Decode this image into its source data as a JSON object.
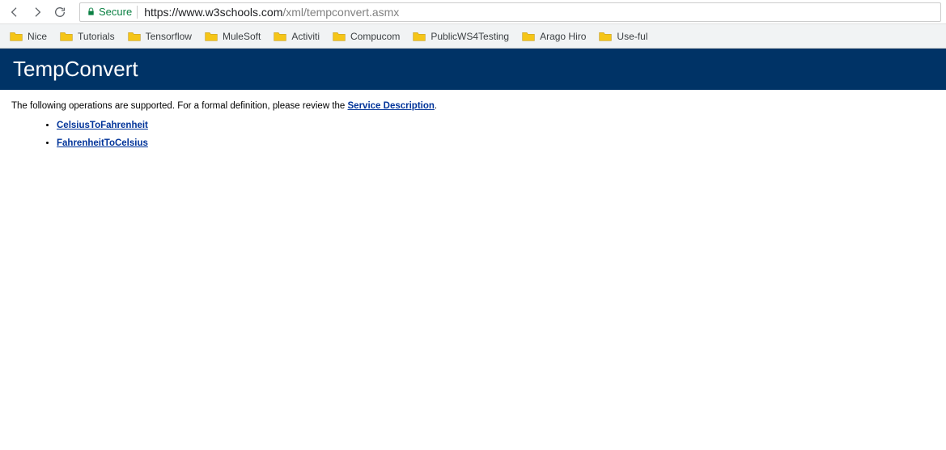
{
  "browser": {
    "secure_label": "Secure",
    "url_origin": "https://www.w3schools.com",
    "url_path": "/xml/tempconvert.asmx"
  },
  "bookmarks": [
    {
      "label": "Nice"
    },
    {
      "label": "Tutorials"
    },
    {
      "label": "Tensorflow"
    },
    {
      "label": "MuleSoft"
    },
    {
      "label": "Activiti"
    },
    {
      "label": "Compucom"
    },
    {
      "label": "PublicWS4Testing"
    },
    {
      "label": "Arago Hiro"
    },
    {
      "label": "Use-ful"
    }
  ],
  "page": {
    "title": "TempConvert",
    "intro_prefix": "The following operations are supported. For a formal definition, please review the ",
    "service_desc_label": "Service Description",
    "intro_suffix": ".",
    "operations": [
      {
        "label": "CelsiusToFahrenheit"
      },
      {
        "label": "FahrenheitToCelsius"
      }
    ]
  }
}
